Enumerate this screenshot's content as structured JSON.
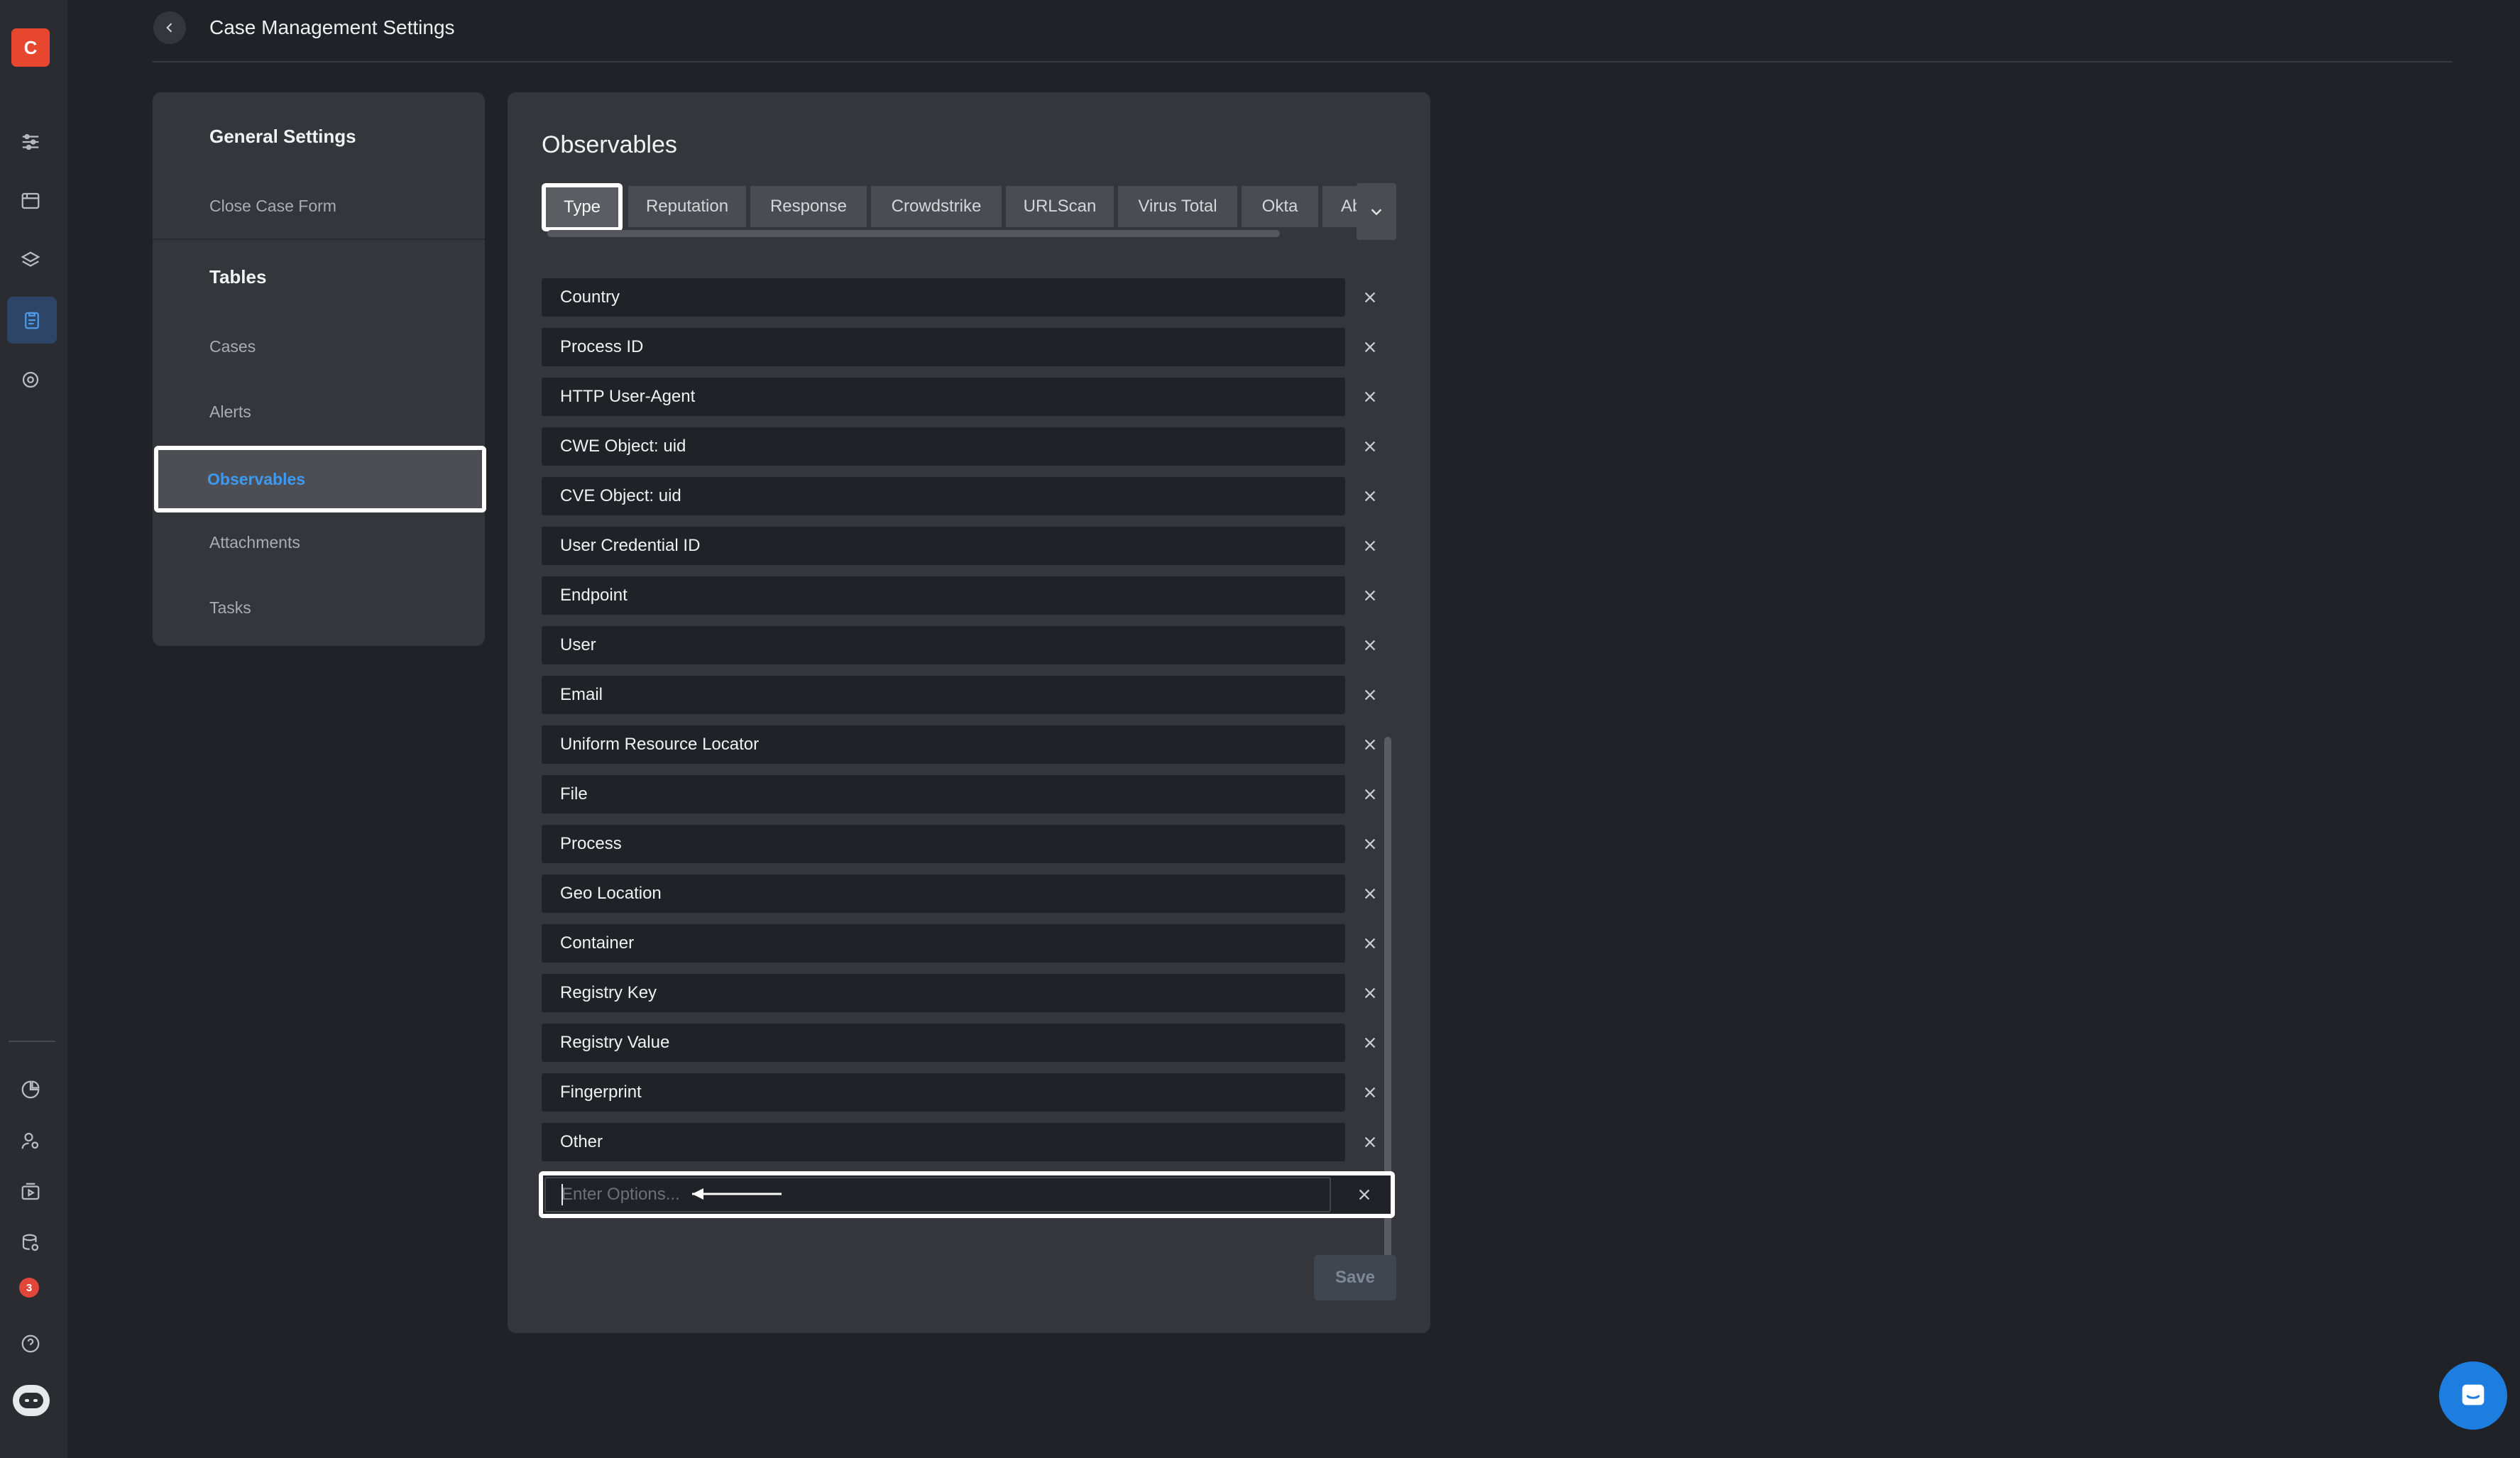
{
  "app": {
    "brand_letter": "C",
    "notification_count": "3",
    "rail_icons_top": [
      "sliders-icon",
      "window-icon",
      "layers-icon",
      "clipboard-icon",
      "settings-icon"
    ],
    "rail_icons_bottom": [
      "pie-chart-icon",
      "user-settings-icon",
      "play-box-icon",
      "database-icon",
      "notification-icon",
      "help-icon",
      "bot-icon"
    ],
    "accent_color": "#3d9af0",
    "brand_color": "#e8472f"
  },
  "header": {
    "title": "Case Management Settings",
    "back_icon": "chevron-left-icon"
  },
  "nav": {
    "general_settings": "General Settings",
    "close_case_form": "Close Case Form",
    "tables": "Tables",
    "cases": "Cases",
    "alerts": "Alerts",
    "observables": "Observables",
    "attachments": "Attachments",
    "tasks": "Tasks",
    "selected": "Observables"
  },
  "panel": {
    "title": "Observables",
    "tabs": [
      {
        "label": "Type",
        "selected": true
      },
      {
        "label": "Reputation"
      },
      {
        "label": "Response"
      },
      {
        "label": "Crowdstrike"
      },
      {
        "label": "URLScan"
      },
      {
        "label": "Virus Total"
      },
      {
        "label": "Okta"
      },
      {
        "label": "Abu"
      }
    ],
    "options": [
      "Country",
      "Process ID",
      "HTTP User-Agent",
      "CWE Object: uid",
      "CVE Object: uid",
      "User Credential ID",
      "Endpoint",
      "User",
      "Email",
      "Uniform Resource Locator",
      "File",
      "Process",
      "Geo Location",
      "Container",
      "Registry Key",
      "Registry Value",
      "Fingerprint",
      "Other"
    ],
    "new_option": {
      "value": "",
      "placeholder": "Enter Options..."
    },
    "save_label": "Save"
  }
}
